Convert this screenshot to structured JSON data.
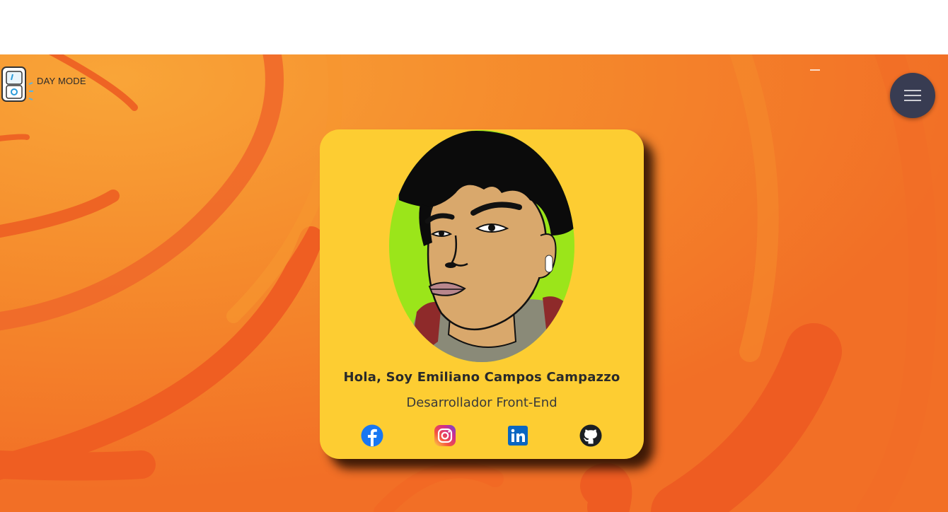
{
  "theme_toggle": {
    "label": "DAY MODE",
    "icon": "light-switch-icon"
  },
  "nav": {
    "menu_icon": "hamburger-icon"
  },
  "profile": {
    "greeting": "Hola, Soy Emiliano Campos Campazzo",
    "role": "Desarrollador Front-End",
    "avatar_icon": "avatar-illustration"
  },
  "socials": [
    {
      "name": "facebook",
      "icon": "facebook-icon"
    },
    {
      "name": "instagram",
      "icon": "instagram-icon"
    },
    {
      "name": "linkedin",
      "icon": "linkedin-icon"
    },
    {
      "name": "github",
      "icon": "github-icon"
    }
  ],
  "colors": {
    "background": "#f47b28",
    "swirl": "#ef5a22",
    "swirl_light": "#f8a33a",
    "card": "#fdcd32",
    "menu_button": "#383c52",
    "avatar_backdrop": "#9be51a"
  }
}
